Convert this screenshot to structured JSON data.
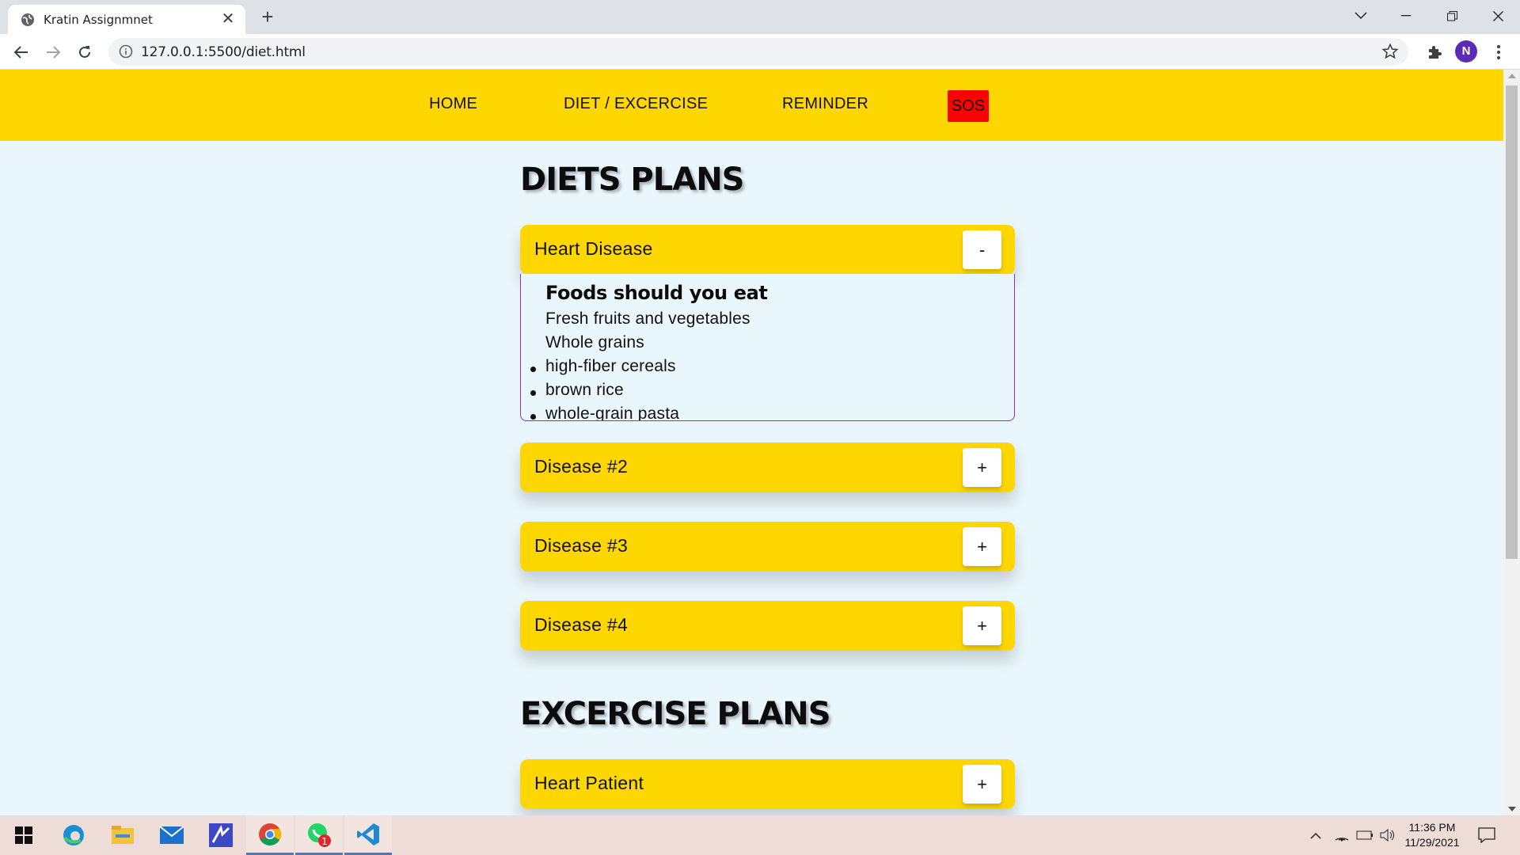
{
  "browser": {
    "tab_title": "Kratin Assignmnet",
    "url": "127.0.0.1:5500/diet.html",
    "profile_initial": "N"
  },
  "nav": {
    "home": "HOME",
    "diet": "DIET / EXCERCISE",
    "reminder": "REMINDER",
    "sos": "SOS"
  },
  "diet_section": {
    "title": "DIETS PLANS",
    "items": [
      {
        "label": "Heart Disease",
        "toggle": "-"
      },
      {
        "label": "Disease #2",
        "toggle": "+"
      },
      {
        "label": "Disease #3",
        "toggle": "+"
      },
      {
        "label": "Disease #4",
        "toggle": "+"
      }
    ],
    "expanded": {
      "heading": "Foods should you eat",
      "lines": [
        "Fresh fruits and vegetables",
        "Whole grains"
      ],
      "bullets": [
        "high-fiber cereals",
        "brown rice",
        "whole-grain pasta"
      ]
    }
  },
  "exercise_section": {
    "title": "EXCERCISE PLANS",
    "items": [
      {
        "label": "Heart Patient",
        "toggle": "+"
      }
    ]
  },
  "taskbar": {
    "time": "11:36 PM",
    "date": "11/29/2021",
    "whatsapp_badge": "1"
  },
  "colors": {
    "nav_bg": "#ffd700",
    "sos_bg": "#ff0000",
    "page_bg": "#e9f6fc",
    "accordion_bg": "#ffd700",
    "panel_border": "#8a2be2"
  }
}
